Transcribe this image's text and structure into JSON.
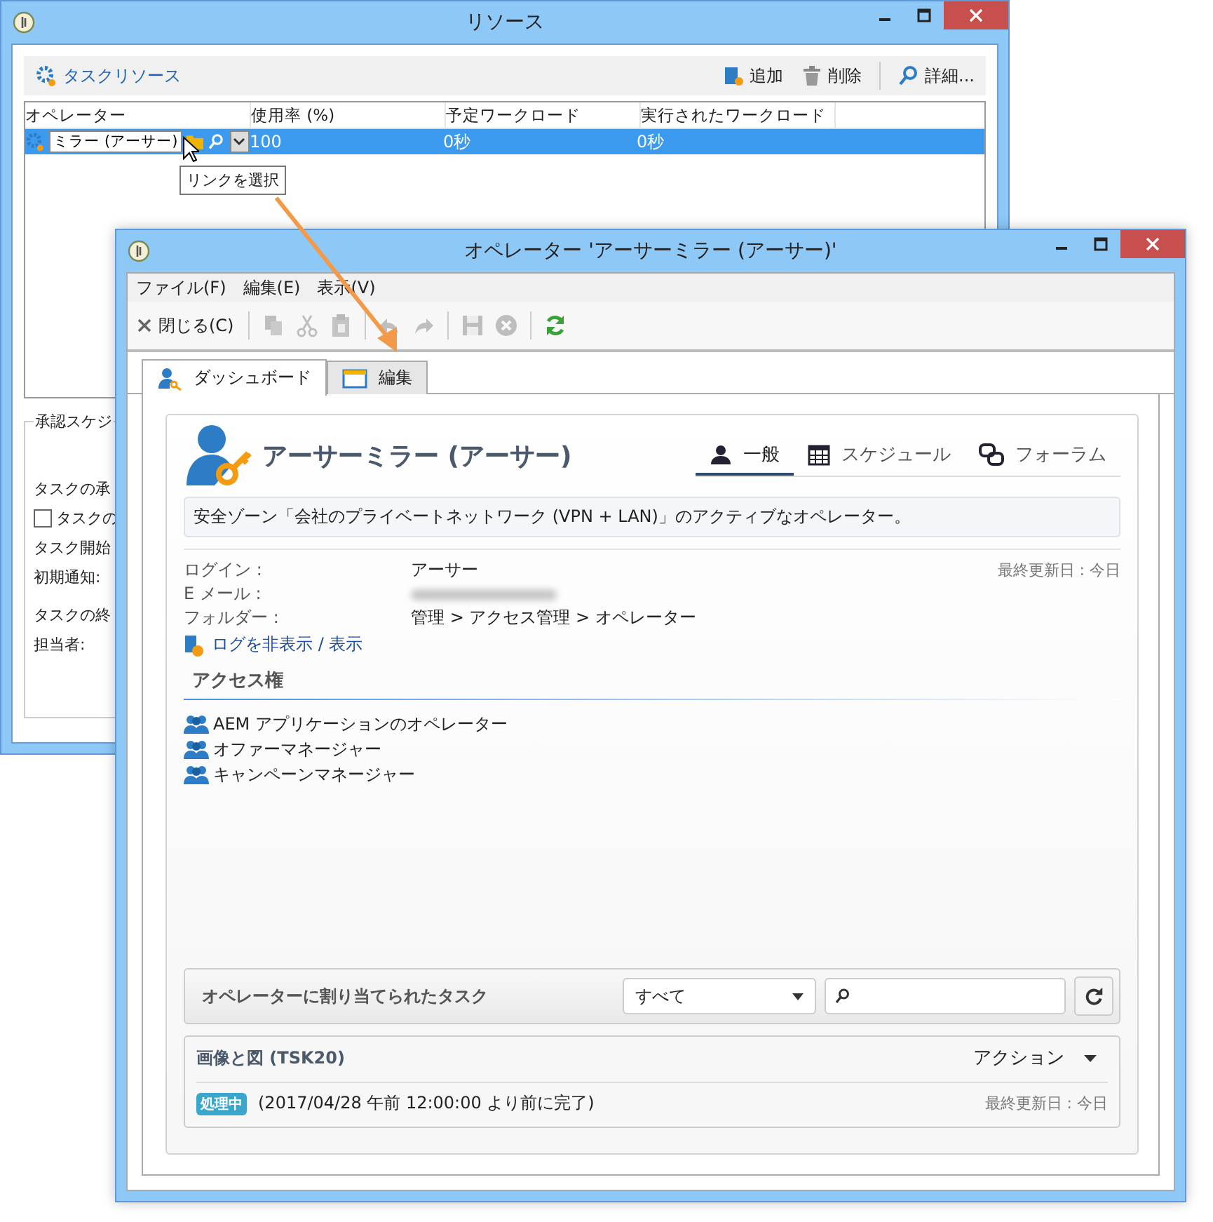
{
  "back_window": {
    "title": "リソース",
    "toolbar": {
      "title": "タスクリソース",
      "buttons": [
        {
          "label": "追加",
          "kind": "add"
        },
        {
          "label": "削除",
          "kind": "delete"
        },
        {
          "label": "詳細...",
          "kind": "details"
        }
      ]
    },
    "table": {
      "columns": [
        "オペレーター",
        "使用率 (%)",
        "予定ワークロード",
        "実行されたワークロード"
      ],
      "rows": [
        {
          "operator": "ミラー (アーサー)",
          "usage": "100",
          "planned": "0秒",
          "actual": "0秒",
          "selected": true
        }
      ]
    },
    "tooltip": "リンクを選択",
    "schedule": {
      "legend": "承認スケジ",
      "fields": [
        {
          "label": "タスクの承",
          "kind": "text"
        },
        {
          "label": "タスクの",
          "kind": "checkbox",
          "checked": false
        },
        {
          "label": "タスク開始",
          "kind": "text"
        },
        {
          "label": "初期通知:",
          "kind": "text"
        },
        {
          "label": "タスクの終",
          "kind": "text"
        },
        {
          "label": "担当者:",
          "kind": "text"
        }
      ]
    }
  },
  "operator_window": {
    "title": "オペレーター 'アーサーミラー (アーサー)'",
    "menu": [
      "ファイル(F)",
      "編集(E)",
      "表示(V)"
    ],
    "toolbar": {
      "close": "閉じる(C)",
      "icons": [
        {
          "kind": "copy",
          "disabled": true
        },
        {
          "kind": "cut",
          "disabled": true
        },
        {
          "kind": "paste",
          "disabled": true
        },
        {
          "kind": "undo",
          "disabled": true
        },
        {
          "kind": "redo",
          "disabled": true
        },
        {
          "kind": "save",
          "disabled": true
        },
        {
          "kind": "cancel",
          "disabled": true
        },
        {
          "kind": "refresh",
          "disabled": false
        }
      ]
    },
    "tabs": [
      {
        "label": "ダッシュボード",
        "kind": "dashboard",
        "selected": true
      },
      {
        "label": "編集",
        "kind": "edit",
        "selected": false
      }
    ],
    "profile": {
      "name": "アーサーミラー (アーサー)",
      "views": [
        {
          "label": "一般",
          "kind": "general",
          "selected": true
        },
        {
          "label": "スケジュール",
          "kind": "schedule",
          "selected": false
        },
        {
          "label": "フォーラム",
          "kind": "forum",
          "selected": false
        }
      ],
      "description": "安全ゾーン「会社のプライベートネットワーク (VPN + LAN)」のアクティブなオペレーター。",
      "fields": [
        {
          "label": "ログイン :",
          "value": "アーサー",
          "kind": "text"
        },
        {
          "label": "E メール :",
          "kind": "blurred"
        },
        {
          "label": "フォルダー :",
          "value": "管理 > アクセス管理 > オペレーター",
          "kind": "text"
        }
      ],
      "last_updated": "最終更新日 : 今日",
      "log_link": "ログを非表示 / 表示"
    },
    "access": {
      "heading": "アクセス権",
      "items": [
        "AEM アプリケーションのオペレーター",
        "オファーマネージャー",
        "キャンペーンマネージャー"
      ]
    },
    "tasks": {
      "heading": "オペレーターに割り当てられたタスク",
      "filter": "すべて",
      "items": [
        {
          "title": "画像と図 (TSK20)",
          "action": "アクション",
          "status": "処理中",
          "text": "(2017/04/28 午前 12:00:00 より前に完了)",
          "last_updated": "最終更新日 : 今日"
        }
      ]
    }
  }
}
